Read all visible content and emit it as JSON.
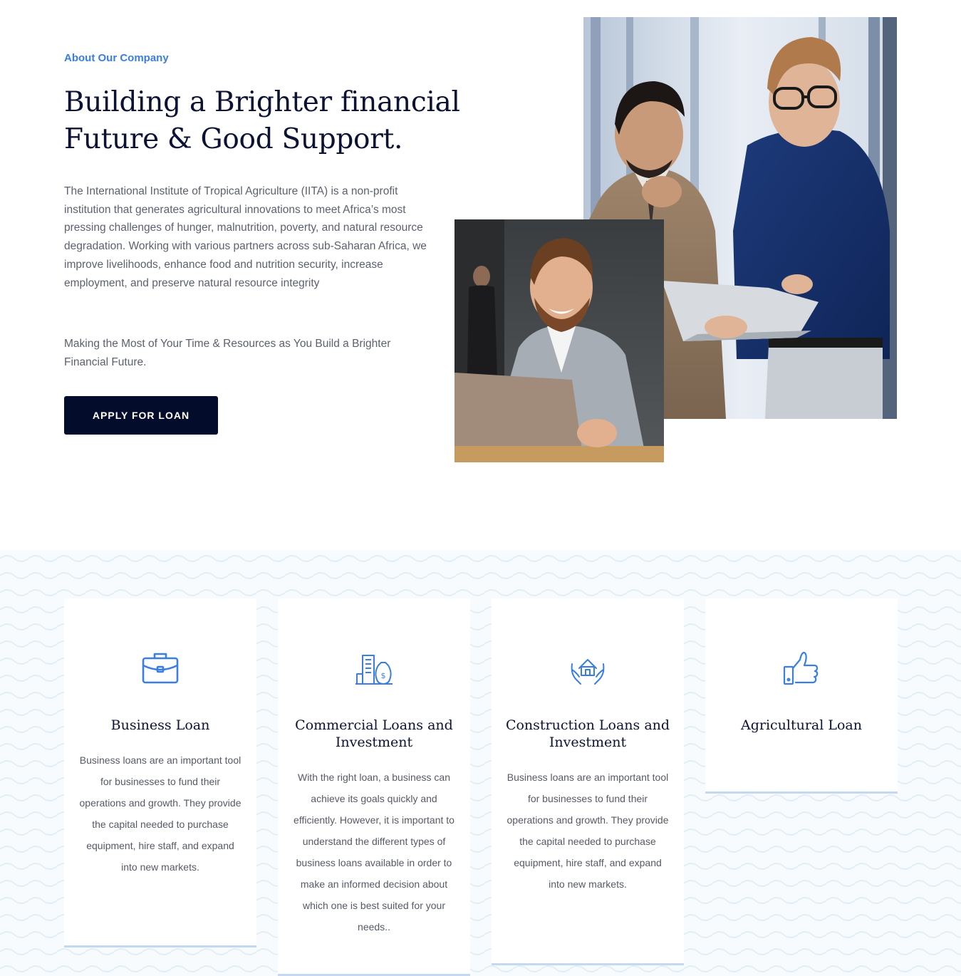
{
  "about": {
    "eyebrow": "About Our Company",
    "headline_line1": "Building a Brighter financial",
    "headline_line2": "Future & Good Support.",
    "paragraph": "The International Institute of Tropical Agriculture (IITA) is a non-profit institution that generates agricultural innovations to meet Africa’s most pressing challenges of hunger, malnutrition, poverty, and natural resource degradation. Working with various partners across sub-Saharan Africa, we improve livelihoods, enhance food and nutrition security, increase employment, and preserve natural resource integrity",
    "tagline": "Making the Most of Your Time & Resources as You Build a Brighter Financial Future.",
    "cta_label": "APPLY FOR LOAN"
  },
  "cards": [
    {
      "icon": "briefcase-icon",
      "title": "Business Loan",
      "text": "Business loans are an important tool for businesses to fund their operations and growth. They provide the capital needed to purchase equipment, hire staff, and expand into new markets."
    },
    {
      "icon": "commercial-building-money-icon",
      "title": "Commercial Loans and Investment",
      "text": "With the right loan, a business can achieve its goals quickly and efficiently. However, it is important to understand the different types of business loans available in order to make an informed decision about which one is best suited for your needs.."
    },
    {
      "icon": "house-in-hands-icon",
      "title": "Construction Loans and Investment",
      "text": "Business loans are an important tool for businesses to fund their operations and growth. They provide the capital needed to purchase equipment, hire staff, and expand into new markets."
    },
    {
      "icon": "thumbs-up-icon",
      "title": "Agricultural Loan",
      "text": ""
    }
  ],
  "colors": {
    "accent": "#3a7ee3",
    "heading": "#0b1233",
    "button_bg": "#040c2c",
    "card_bar": "#c3d8f3",
    "section_bg": "#f7fbfd"
  }
}
